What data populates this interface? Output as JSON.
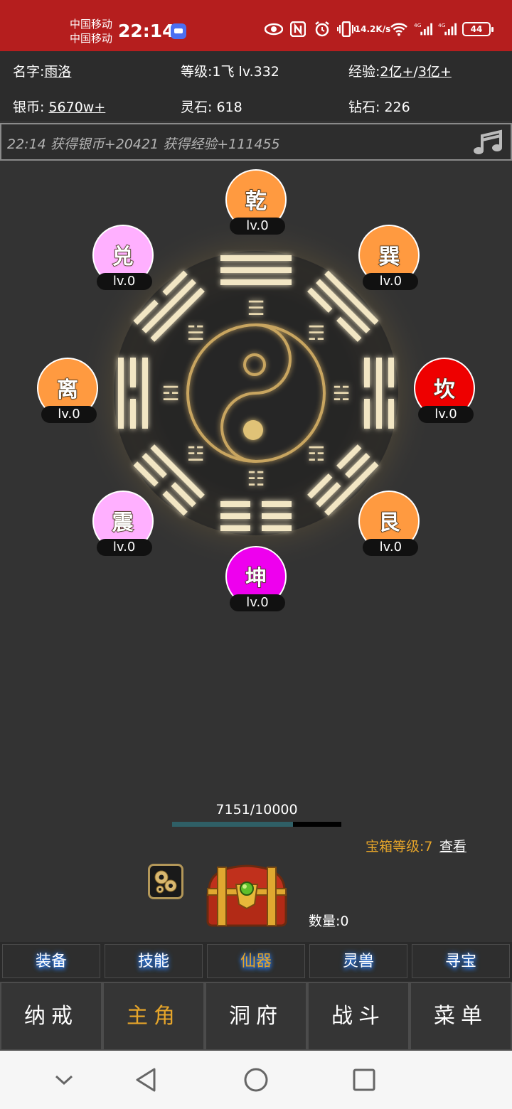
{
  "status_bar": {
    "carrier_1": "中国移动",
    "carrier_2": "中国移动",
    "time": "22:14",
    "net_speed_value": "14.2",
    "net_speed_unit": "K/s",
    "battery": "44",
    "icons": [
      "eye-icon",
      "nfc-icon",
      "alarm-icon",
      "vibrate-icon",
      "wifi-icon",
      "signal-4g-icon",
      "signal-4g-icon",
      "battery-icon"
    ]
  },
  "player": {
    "name_label": "名字:",
    "name": "雨洛",
    "level_label": "等级:",
    "level": "1飞 lv.332",
    "exp_label": "经验:",
    "exp_current": "2亿+",
    "exp_sep": "/",
    "exp_max": "3亿+",
    "silver_label": "银币:",
    "silver": "5670w+",
    "spirit_stone_label": "灵石:",
    "spirit_stone": "618",
    "diamond_label": "钻石:",
    "diamond": "226"
  },
  "message": "22:14 获得银币+20421 获得经验+111455",
  "trigrams": [
    {
      "name": "乾",
      "level": "lv.0",
      "color": "#ff9a40"
    },
    {
      "name": "巽",
      "level": "lv.0",
      "color": "#ff9a40"
    },
    {
      "name": "坎",
      "level": "lv.0",
      "color": "#ee0000"
    },
    {
      "name": "艮",
      "level": "lv.0",
      "color": "#ff9a40"
    },
    {
      "name": "坤",
      "level": "lv.0",
      "color": "#ee00ee"
    },
    {
      "name": "震",
      "level": "lv.0",
      "color": "#ffb0ff"
    },
    {
      "name": "离",
      "level": "lv.0",
      "color": "#ff9a40"
    },
    {
      "name": "兑",
      "level": "lv.0",
      "color": "#ffb0ff"
    }
  ],
  "progress": {
    "current": 7151,
    "max": 10000,
    "text": "7151/10000"
  },
  "chest": {
    "level_text": "宝箱等级:7",
    "view_label": "查看",
    "count_text": "数量:0"
  },
  "sub_tabs": [
    {
      "label": "装备",
      "active": false
    },
    {
      "label": "技能",
      "active": false
    },
    {
      "label": "仙器",
      "active": true
    },
    {
      "label": "灵兽",
      "active": false
    },
    {
      "label": "寻宝",
      "active": false
    }
  ],
  "main_tabs": [
    {
      "label": "纳戒",
      "active": false
    },
    {
      "label": "主角",
      "active": true
    },
    {
      "label": "洞府",
      "active": false
    },
    {
      "label": "战斗",
      "active": false
    },
    {
      "label": "菜单",
      "active": false
    }
  ],
  "colors": {
    "status_bar": "#b51e1e",
    "accent_gold": "#e6a52a",
    "glow_blue": "#2a82ff",
    "background": "#333333"
  }
}
